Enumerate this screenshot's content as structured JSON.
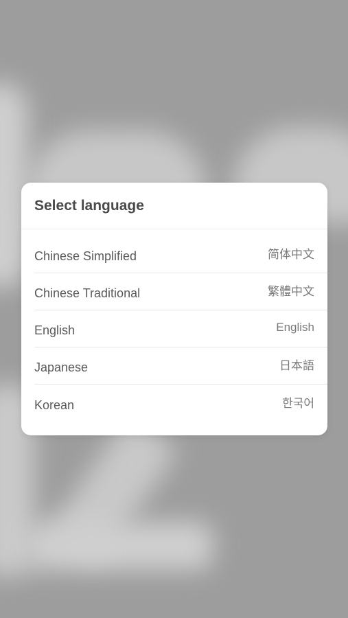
{
  "dialog": {
    "title": "Select language",
    "options": [
      {
        "name": "Chinese Simplified",
        "native": "简体中文"
      },
      {
        "name": "Chinese Traditional",
        "native": "繁體中文"
      },
      {
        "name": "English",
        "native": "English"
      },
      {
        "name": "Japanese",
        "native": "日本語"
      },
      {
        "name": "Korean",
        "native": "한국어"
      }
    ]
  },
  "colors": {
    "backdrop": "#9d9d9d",
    "dialog_bg": "#ffffff",
    "title_text": "#4a4a4a",
    "option_text": "#5a5a5a",
    "native_text": "#7a7a7a"
  }
}
